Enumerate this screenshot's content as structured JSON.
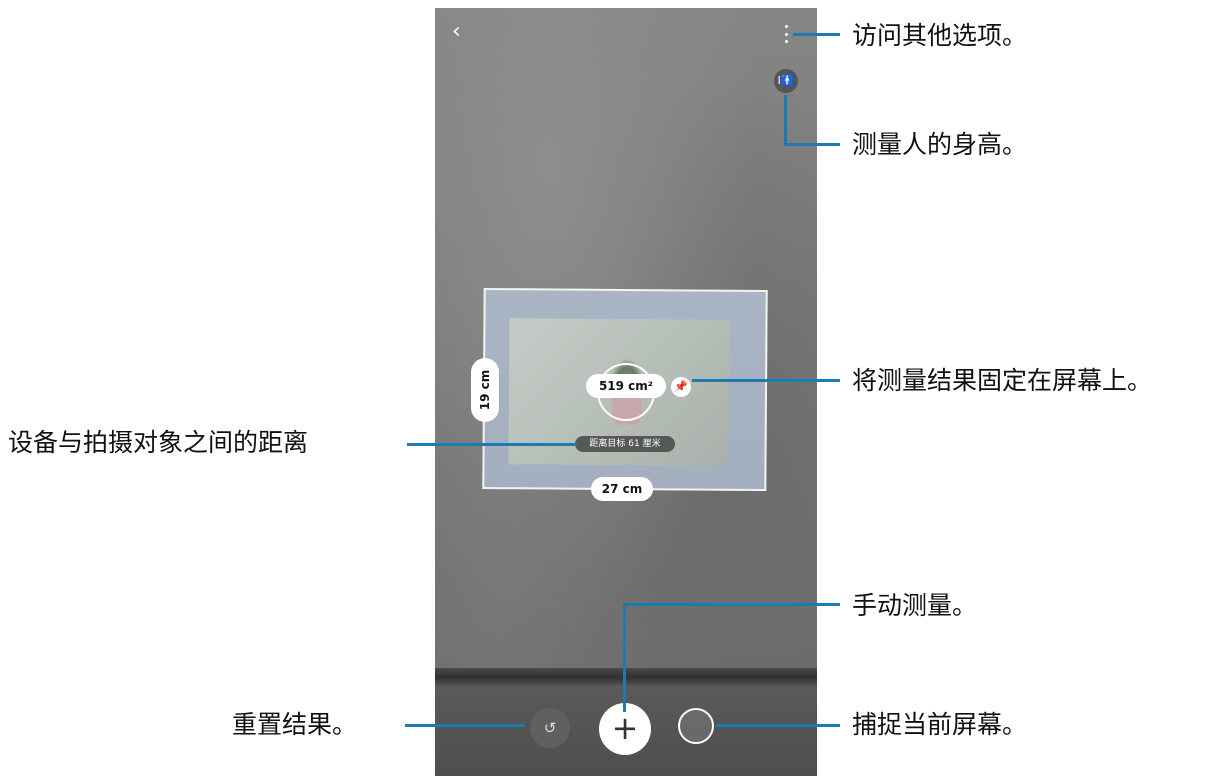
{
  "screen": {
    "back_icon": "back-arrow-icon",
    "more_icon": "more-options-icon",
    "height_icon": "person-height-icon",
    "height_measure_label": "I🚹",
    "area_value": "519 cm²",
    "height_value": "19 cm",
    "width_value": "27 cm",
    "distance_text": "距离目标 61 厘米",
    "pin_icon": "pin-icon",
    "reset_icon": "reset-icon",
    "add_icon": "plus-icon",
    "capture_icon": "capture-icon"
  },
  "callouts": {
    "more_options": "访问其他选项。",
    "measure_height": "测量人的身高。",
    "pin_result": "将测量结果固定在屏幕上。",
    "distance": "设备与拍摄对象之间的距离",
    "manual_measure": "手动测量。",
    "reset": "重置结果。",
    "capture": "捕捉当前屏幕。"
  },
  "colors": {
    "callout_line": "#1e7ab0"
  }
}
